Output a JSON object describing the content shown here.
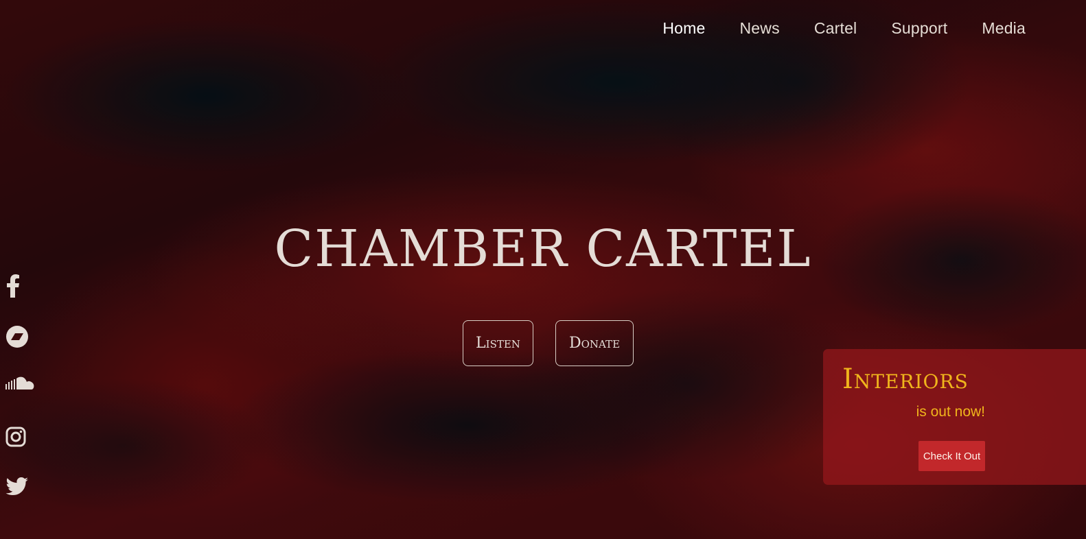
{
  "nav": {
    "items": [
      {
        "label": "Home",
        "active": true
      },
      {
        "label": "News",
        "active": false
      },
      {
        "label": "Cartel",
        "active": false
      },
      {
        "label": "Support",
        "active": false
      },
      {
        "label": "Media",
        "active": false
      }
    ]
  },
  "hero": {
    "title": "CHAMBER CARTEL",
    "listen_label": "Listen",
    "donate_label": "Donate"
  },
  "social": {
    "icons": [
      "facebook-icon",
      "bandcamp-icon",
      "soundcloud-icon",
      "instagram-icon",
      "twitter-icon"
    ]
  },
  "promo": {
    "title": "Interiors",
    "subtitle": "is out now!",
    "button_label": "Check It Out"
  },
  "colors": {
    "accent_gold": "#f0b51c",
    "promo_bg": "#96181c",
    "promo_button": "#c2282b",
    "text_light": "#e4dcd6"
  }
}
